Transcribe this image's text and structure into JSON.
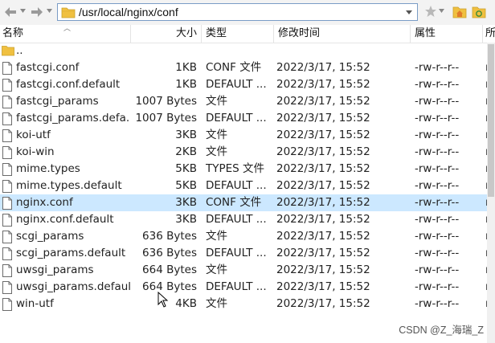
{
  "address": {
    "path": "/usr/local/nginx/conf"
  },
  "icons": {
    "back": "arrow-left-icon",
    "forward": "arrow-right-icon",
    "folder": "folder-icon",
    "bookmark": "star-icon",
    "home": "home-folder-icon",
    "file": "file-icon"
  },
  "columns": {
    "name": "名称",
    "size": "大小",
    "type": "类型",
    "modified": "修改时间",
    "permissions": "属性",
    "owner": "所"
  },
  "parent_row": {
    "name": ".."
  },
  "files": [
    {
      "name": "fastcgi.conf",
      "size": "1KB",
      "type": "CONF 文件",
      "modified": "2022/3/17, 15:52",
      "perm": "-rw-r--r--",
      "owner": "ro",
      "selected": false
    },
    {
      "name": "fastcgi.conf.default",
      "size": "1KB",
      "type": "DEFAULT ...",
      "modified": "2022/3/17, 15:52",
      "perm": "-rw-r--r--",
      "owner": "ro",
      "selected": false
    },
    {
      "name": "fastcgi_params",
      "size": "1007 Bytes",
      "type": "文件",
      "modified": "2022/3/17, 15:52",
      "perm": "-rw-r--r--",
      "owner": "ro",
      "selected": false
    },
    {
      "name": "fastcgi_params.defa...",
      "size": "1007 Bytes",
      "type": "DEFAULT ...",
      "modified": "2022/3/17, 15:52",
      "perm": "-rw-r--r--",
      "owner": "ro",
      "selected": false
    },
    {
      "name": "koi-utf",
      "size": "3KB",
      "type": "文件",
      "modified": "2022/3/17, 15:52",
      "perm": "-rw-r--r--",
      "owner": "ro",
      "selected": false
    },
    {
      "name": "koi-win",
      "size": "2KB",
      "type": "文件",
      "modified": "2022/3/17, 15:52",
      "perm": "-rw-r--r--",
      "owner": "ro",
      "selected": false
    },
    {
      "name": "mime.types",
      "size": "5KB",
      "type": "TYPES 文件",
      "modified": "2022/3/17, 15:52",
      "perm": "-rw-r--r--",
      "owner": "ro",
      "selected": false
    },
    {
      "name": "mime.types.default",
      "size": "5KB",
      "type": "DEFAULT ...",
      "modified": "2022/3/17, 15:52",
      "perm": "-rw-r--r--",
      "owner": "ro",
      "selected": false
    },
    {
      "name": "nginx.conf",
      "size": "3KB",
      "type": "CONF 文件",
      "modified": "2022/3/17, 15:52",
      "perm": "-rw-r--r--",
      "owner": "ro",
      "selected": true
    },
    {
      "name": "nginx.conf.default",
      "size": "3KB",
      "type": "DEFAULT ...",
      "modified": "2022/3/17, 15:52",
      "perm": "-rw-r--r--",
      "owner": "ro",
      "selected": false
    },
    {
      "name": "scgi_params",
      "size": "636 Bytes",
      "type": "文件",
      "modified": "2022/3/17, 15:52",
      "perm": "-rw-r--r--",
      "owner": "ro",
      "selected": false
    },
    {
      "name": "scgi_params.default",
      "size": "636 Bytes",
      "type": "DEFAULT ...",
      "modified": "2022/3/17, 15:52",
      "perm": "-rw-r--r--",
      "owner": "ro",
      "selected": false
    },
    {
      "name": "uwsgi_params",
      "size": "664 Bytes",
      "type": "文件",
      "modified": "2022/3/17, 15:52",
      "perm": "-rw-r--r--",
      "owner": "ro",
      "selected": false
    },
    {
      "name": "uwsgi_params.default",
      "size": "664 Bytes",
      "type": "DEFAULT ...",
      "modified": "2022/3/17, 15:52",
      "perm": "-rw-r--r--",
      "owner": "ro",
      "selected": false
    },
    {
      "name": "win-utf",
      "size": "4KB",
      "type": "文件",
      "modified": "2022/3/17, 15:52",
      "perm": "-rw-r--r--",
      "owner": "ro",
      "selected": false
    }
  ],
  "watermark": "CSDN @Z_海瑞_Z",
  "colors": {
    "selection": "#cce8ff",
    "folder": "#f0c040",
    "home": "#e07b2a",
    "star": "#b9b9b9"
  }
}
